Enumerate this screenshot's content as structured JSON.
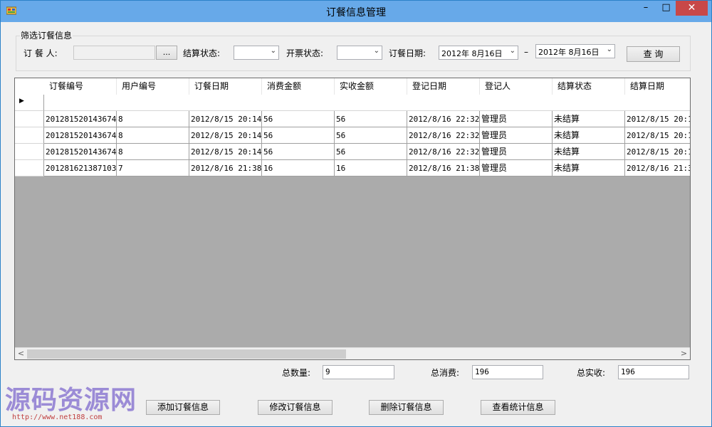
{
  "window": {
    "title": "订餐信息管理",
    "min_glyph": "–",
    "max_glyph": "□",
    "close_glyph": "✕"
  },
  "filter": {
    "group_title": "筛选订餐信息",
    "orderer_label": "订 餐 人:",
    "orderer_value": "",
    "browse_label": "...",
    "settle_label": "结算状态:",
    "settle_value": "",
    "invoice_label": "开票状态:",
    "invoice_value": "",
    "date_label": "订餐日期:",
    "date_from": "2012年 8月16日",
    "date_sep": "–",
    "date_to": "2012年 8月16日",
    "query_label": "查 询"
  },
  "grid": {
    "columns": [
      "订餐编号",
      "用户编号",
      "订餐日期",
      "消费金额",
      "实收金额",
      "登记日期",
      "登记人",
      "结算状态",
      "结算日期"
    ],
    "current_row_marker": "▶",
    "rows": [
      [
        "201281520143674",
        "8",
        "2012/8/15 20:14",
        "56",
        "56",
        "2012/8/16 22:32",
        "管理员",
        "未结算",
        "2012/8/15 20:1"
      ],
      [
        "201281520143674",
        "8",
        "2012/8/15 20:14",
        "56",
        "56",
        "2012/8/16 22:32",
        "管理员",
        "未结算",
        "2012/8/15 20:1"
      ],
      [
        "201281520143674",
        "8",
        "2012/8/15 20:14",
        "56",
        "56",
        "2012/8/16 22:32",
        "管理员",
        "未结算",
        "2012/8/15 20:1"
      ],
      [
        "201281621387103",
        "7",
        "2012/8/16 21:38",
        "16",
        "16",
        "2012/8/16 21:38",
        "管理员",
        "未结算",
        "2012/8/16 21:3"
      ]
    ],
    "scroll_left": "<",
    "scroll_right": ">"
  },
  "totals": {
    "count_label": "总数量:",
    "count_value": "9",
    "consume_label": "总消费:",
    "consume_value": "196",
    "received_label": "总实收:",
    "received_value": "196"
  },
  "actions": {
    "add": "添加订餐信息",
    "edit": "修改订餐信息",
    "delete": "删除订餐信息",
    "stats": "查看统计信息"
  },
  "watermark": {
    "text": "源码资源网",
    "url": "http://www.net188.com"
  }
}
